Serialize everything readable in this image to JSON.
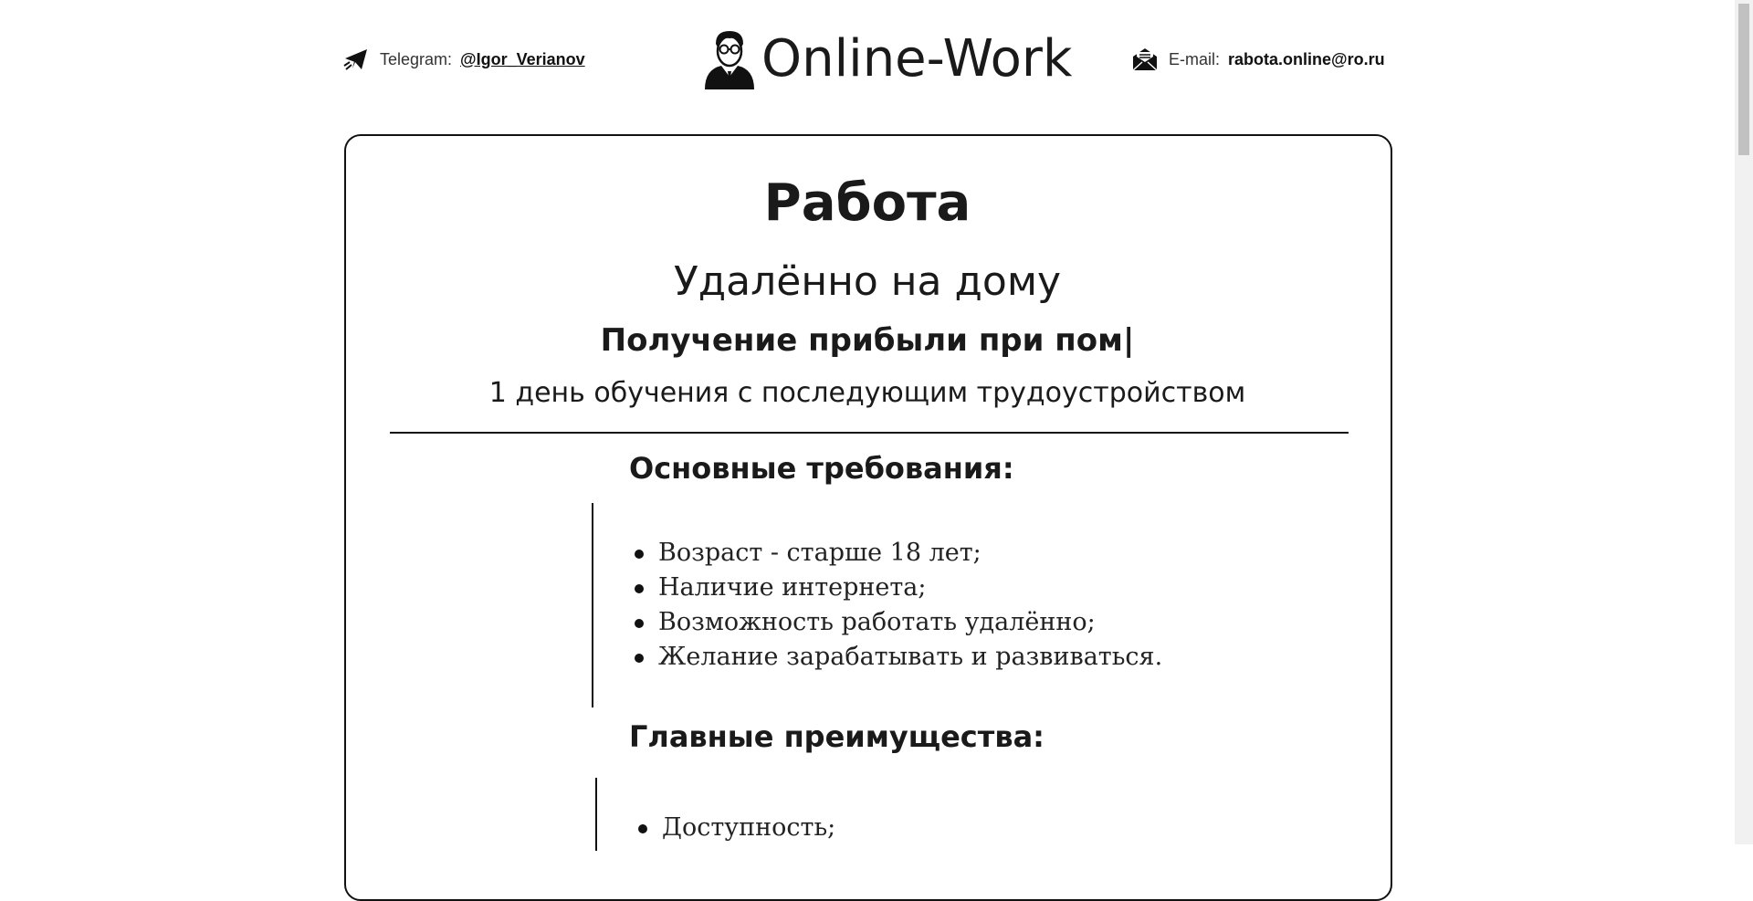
{
  "header": {
    "telegram_label": "Telegram:",
    "telegram_value": "@Igor_Verianov",
    "logo_text": "Online-Work",
    "email_label": "E-mail:",
    "email_value": "rabota.online@ro.ru"
  },
  "hero": {
    "title": "Работа",
    "subtitle": "Удалённо на дому",
    "typing_text": "Получение прибыли при пом|",
    "tagline": "1 день обучения с последующим трудоустройством"
  },
  "requirements": {
    "title": "Основные требования:",
    "items": [
      "Возраст - старше 18 лет;",
      "Наличие интернета;",
      "Возможность работать удалённо;",
      "Желание зарабатывать и развиваться."
    ]
  },
  "advantages": {
    "title": "Главные преимущества:",
    "items": [
      "Доступность;"
    ]
  },
  "icons": {
    "telegram": "paper-plane-icon",
    "email": "envelope-icon",
    "logo": "man-with-glasses-icon"
  },
  "colors": {
    "text": "#1a1a1a",
    "border": "#111111",
    "background": "#ffffff"
  }
}
